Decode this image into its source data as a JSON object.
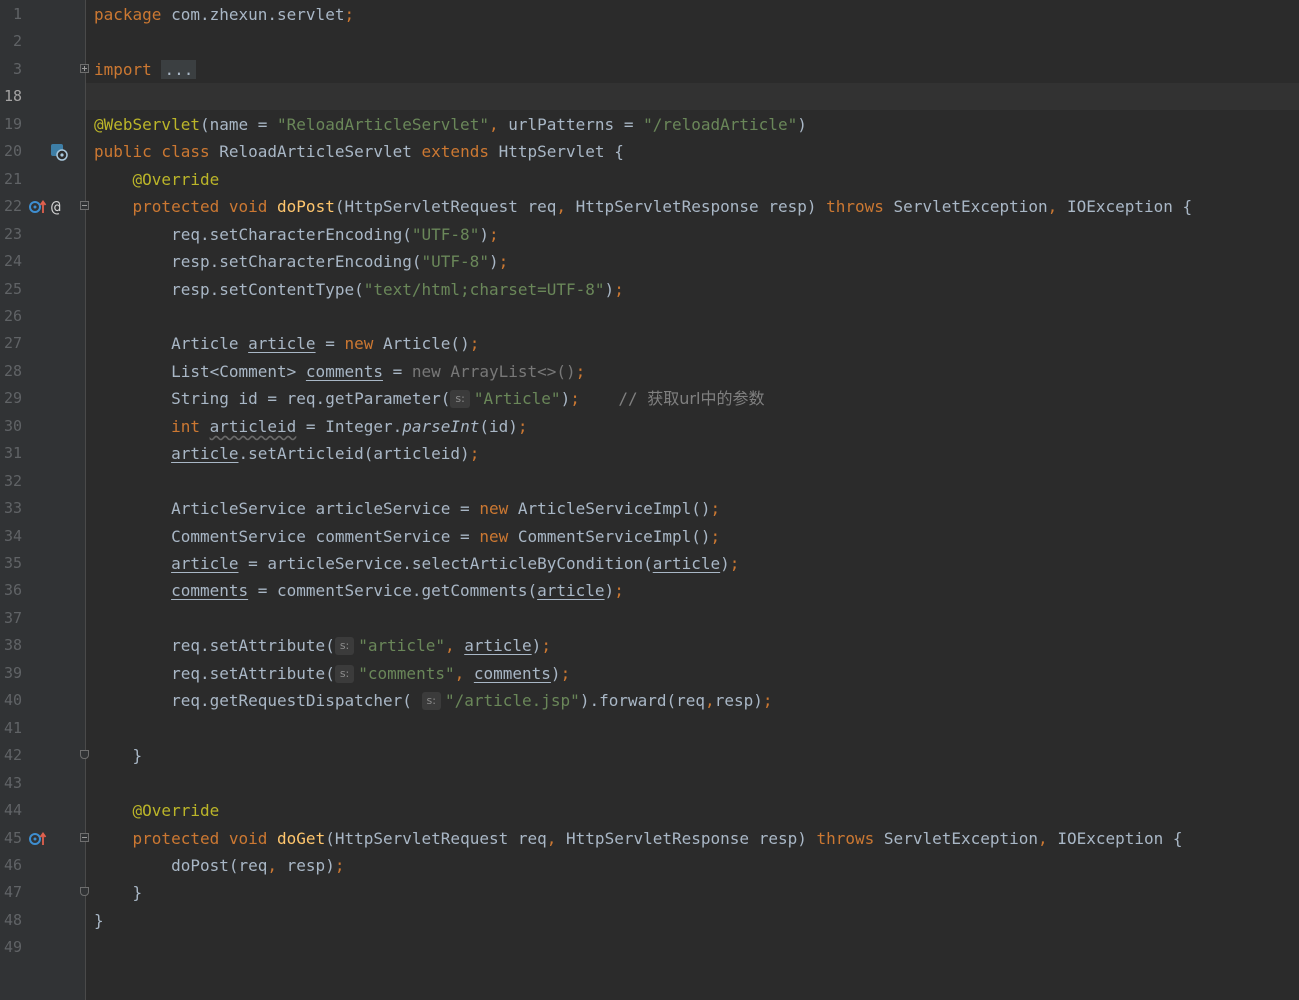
{
  "editor": {
    "current_line": "18",
    "lines": [
      {
        "n": "1",
        "t": [
          {
            "k": "kw",
            "s": "package "
          },
          {
            "s": "com.zhexun.servlet"
          },
          {
            "k": "kw",
            "s": ";"
          }
        ]
      },
      {
        "n": "2",
        "t": []
      },
      {
        "n": "3",
        "fold": "plus",
        "t": [
          {
            "k": "kw",
            "s": "import "
          },
          {
            "k": "chip",
            "s": "..."
          }
        ]
      },
      {
        "n": "18",
        "t": []
      },
      {
        "n": "19",
        "t": [
          {
            "k": "ann",
            "s": "@WebServlet"
          },
          {
            "s": "(name = "
          },
          {
            "k": "str",
            "s": "\"ReloadArticleServlet\""
          },
          {
            "k": "kw",
            "s": ", "
          },
          {
            "s": "urlPatterns = "
          },
          {
            "k": "str",
            "s": "\"/reloadArticle\""
          },
          {
            "s": ")"
          }
        ]
      },
      {
        "n": "20",
        "icon": "servlet-icon",
        "t": [
          {
            "k": "kw",
            "s": "public class "
          },
          {
            "s": "ReloadArticleServlet "
          },
          {
            "k": "kw",
            "s": "extends "
          },
          {
            "s": "HttpServlet {"
          }
        ]
      },
      {
        "n": "21",
        "t": [
          {
            "s": "    "
          },
          {
            "k": "ann",
            "s": "@Override"
          }
        ]
      },
      {
        "n": "22",
        "icon": "override-up-icon",
        "icon2": "at-icon",
        "fold": "minus",
        "t": [
          {
            "s": "    "
          },
          {
            "k": "kw",
            "s": "protected void "
          },
          {
            "k": "fn",
            "s": "doPost"
          },
          {
            "s": "(HttpServletRequest req"
          },
          {
            "k": "kw",
            "s": ", "
          },
          {
            "s": "HttpServletResponse resp) "
          },
          {
            "k": "kw",
            "s": "throws "
          },
          {
            "s": "ServletException"
          },
          {
            "k": "kw",
            "s": ", "
          },
          {
            "s": "IOException {"
          }
        ]
      },
      {
        "n": "23",
        "t": [
          {
            "s": "        req.setCharacterEncoding("
          },
          {
            "k": "str",
            "s": "\"UTF-8\""
          },
          {
            "s": ")"
          },
          {
            "k": "kw",
            "s": ";"
          }
        ]
      },
      {
        "n": "24",
        "t": [
          {
            "s": "        resp.setCharacterEncoding("
          },
          {
            "k": "str",
            "s": "\"UTF-8\""
          },
          {
            "s": ")"
          },
          {
            "k": "kw",
            "s": ";"
          }
        ]
      },
      {
        "n": "25",
        "t": [
          {
            "s": "        resp.setContentType("
          },
          {
            "k": "str",
            "s": "\"text/html;charset=UTF-8\""
          },
          {
            "s": ")"
          },
          {
            "k": "kw",
            "s": ";"
          }
        ]
      },
      {
        "n": "26",
        "t": []
      },
      {
        "n": "27",
        "t": [
          {
            "s": "        Article "
          },
          {
            "k": "ul",
            "s": "article"
          },
          {
            "s": " = "
          },
          {
            "k": "kw",
            "s": "new "
          },
          {
            "s": "Article()"
          },
          {
            "k": "kw",
            "s": ";"
          }
        ]
      },
      {
        "n": "28",
        "t": [
          {
            "s": "        List<Comment> "
          },
          {
            "k": "ul",
            "s": "comments"
          },
          {
            "s": " = "
          },
          {
            "k": "dim",
            "s": "new ArrayList<>()"
          },
          {
            "k": "kw",
            "s": ";"
          }
        ]
      },
      {
        "n": "29",
        "t": [
          {
            "s": "        String id = req.getParameter("
          },
          {
            "k": "hint",
            "s": "s:"
          },
          {
            "k": "str",
            "s": "\"Article\""
          },
          {
            "s": ")"
          },
          {
            "k": "kw",
            "s": ";"
          },
          {
            "s": "    "
          },
          {
            "k": "cmt",
            "s": "// "
          },
          {
            "k": "cmtcjk",
            "s": "获取url中的参数"
          }
        ]
      },
      {
        "n": "30",
        "t": [
          {
            "s": "        "
          },
          {
            "k": "kw",
            "s": "int "
          },
          {
            "k": "wavy",
            "s": "articleid"
          },
          {
            "s": " = Integer."
          },
          {
            "k": "it",
            "s": "parseInt"
          },
          {
            "s": "(id)"
          },
          {
            "k": "kw",
            "s": ";"
          }
        ]
      },
      {
        "n": "31",
        "t": [
          {
            "s": "        "
          },
          {
            "k": "ul",
            "s": "article"
          },
          {
            "s": ".setArticleid(articleid)"
          },
          {
            "k": "kw",
            "s": ";"
          }
        ]
      },
      {
        "n": "32",
        "t": []
      },
      {
        "n": "33",
        "t": [
          {
            "s": "        ArticleService articleService = "
          },
          {
            "k": "kw",
            "s": "new "
          },
          {
            "s": "ArticleServiceImpl()"
          },
          {
            "k": "kw",
            "s": ";"
          }
        ]
      },
      {
        "n": "34",
        "t": [
          {
            "s": "        CommentService commentService = "
          },
          {
            "k": "kw",
            "s": "new "
          },
          {
            "s": "CommentServiceImpl()"
          },
          {
            "k": "kw",
            "s": ";"
          }
        ]
      },
      {
        "n": "35",
        "t": [
          {
            "s": "        "
          },
          {
            "k": "ul",
            "s": "article"
          },
          {
            "s": " = articleService.selectArticleByCondition("
          },
          {
            "k": "ul",
            "s": "article"
          },
          {
            "s": ")"
          },
          {
            "k": "kw",
            "s": ";"
          }
        ]
      },
      {
        "n": "36",
        "t": [
          {
            "s": "        "
          },
          {
            "k": "ul",
            "s": "comments"
          },
          {
            "s": " = commentService.getComments("
          },
          {
            "k": "ul",
            "s": "article"
          },
          {
            "s": ")"
          },
          {
            "k": "kw",
            "s": ";"
          }
        ]
      },
      {
        "n": "37",
        "t": []
      },
      {
        "n": "38",
        "t": [
          {
            "s": "        req.setAttribute("
          },
          {
            "k": "hint",
            "s": "s:"
          },
          {
            "k": "str",
            "s": "\"article\""
          },
          {
            "k": "kw",
            "s": ", "
          },
          {
            "k": "ul",
            "s": "article"
          },
          {
            "s": ")"
          },
          {
            "k": "kw",
            "s": ";"
          }
        ]
      },
      {
        "n": "39",
        "t": [
          {
            "s": "        req.setAttribute("
          },
          {
            "k": "hint",
            "s": "s:"
          },
          {
            "k": "str",
            "s": "\"comments\""
          },
          {
            "k": "kw",
            "s": ", "
          },
          {
            "k": "ul",
            "s": "comments"
          },
          {
            "s": ")"
          },
          {
            "k": "kw",
            "s": ";"
          }
        ]
      },
      {
        "n": "40",
        "t": [
          {
            "s": "        req.getRequestDispatcher( "
          },
          {
            "k": "hint",
            "s": "s:"
          },
          {
            "k": "str",
            "s": "\"/article.jsp\""
          },
          {
            "s": ").forward(req"
          },
          {
            "k": "kw",
            "s": ","
          },
          {
            "s": "resp)"
          },
          {
            "k": "kw",
            "s": ";"
          }
        ]
      },
      {
        "n": "41",
        "t": []
      },
      {
        "n": "42",
        "fold": "end",
        "t": [
          {
            "s": "    }"
          }
        ]
      },
      {
        "n": "43",
        "t": []
      },
      {
        "n": "44",
        "t": [
          {
            "s": "    "
          },
          {
            "k": "ann",
            "s": "@Override"
          }
        ]
      },
      {
        "n": "45",
        "icon": "override-up-icon",
        "fold": "minus",
        "t": [
          {
            "s": "    "
          },
          {
            "k": "kw",
            "s": "protected void "
          },
          {
            "k": "fn",
            "s": "doGet"
          },
          {
            "s": "(HttpServletRequest req"
          },
          {
            "k": "kw",
            "s": ", "
          },
          {
            "s": "HttpServletResponse resp) "
          },
          {
            "k": "kw",
            "s": "throws "
          },
          {
            "s": "ServletException"
          },
          {
            "k": "kw",
            "s": ", "
          },
          {
            "s": "IOException {"
          }
        ]
      },
      {
        "n": "46",
        "t": [
          {
            "s": "        doPost(req"
          },
          {
            "k": "kw",
            "s": ", "
          },
          {
            "s": "resp)"
          },
          {
            "k": "kw",
            "s": ";"
          }
        ]
      },
      {
        "n": "47",
        "fold": "end",
        "t": [
          {
            "s": "    }"
          }
        ]
      },
      {
        "n": "48",
        "t": [
          {
            "s": "}"
          }
        ]
      },
      {
        "n": "49",
        "t": []
      }
    ]
  }
}
